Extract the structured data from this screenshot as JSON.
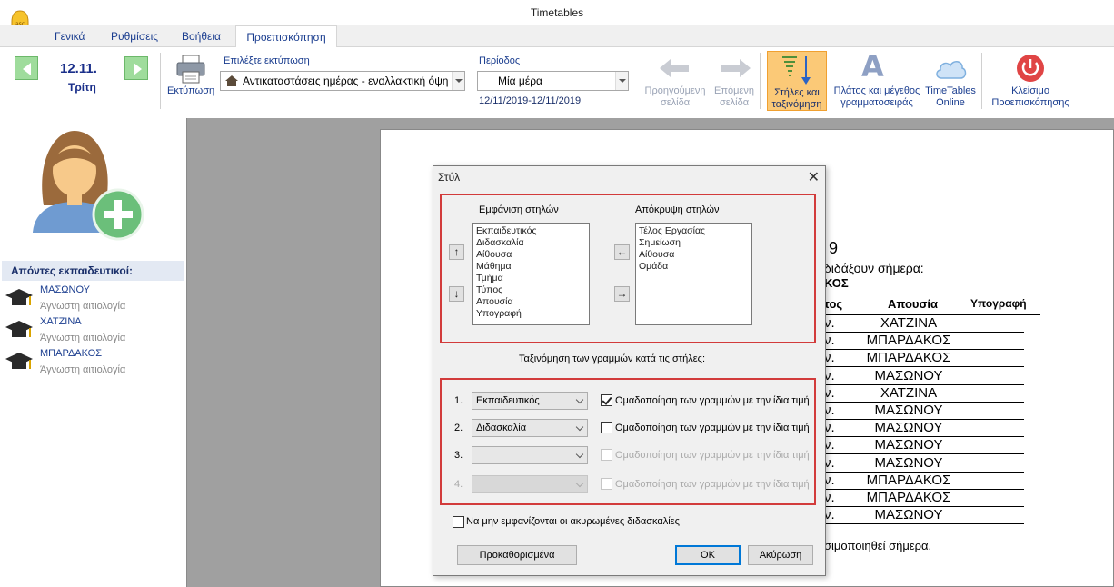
{
  "window": {
    "title": "Timetables"
  },
  "menu": {
    "tabs": [
      "Γενικά",
      "Ρυθμίσεις",
      "Βοήθεια",
      "Προεπισκόπηση"
    ],
    "active_tab": "Προεπισκόπηση"
  },
  "ribbon": {
    "date": "12.11.",
    "day": "Τρίτη",
    "print_label": "Εκτύπωση",
    "choose_print_label": "Επιλέξτε εκτύπωση",
    "print_select_value": "Αντικαταστάσεις ημέρας - εναλλακτική όψη",
    "period_label": "Περίοδος",
    "period_value": "Μία μέρα",
    "period_range": "12/11/2019-12/11/2019",
    "prev_page": "Προηγούμενη σελίδα",
    "next_page": "Επόμενη σελίδα",
    "columns_sort": "Στήλες και ταξινόμηση",
    "font_size": "Πλάτος και μέγεθος γραμματοσειράς",
    "timetables_online": "TimeTables Online",
    "close_preview": "Κλείσιμο Προεπισκόπησης",
    "accent": "#fbc977"
  },
  "left": {
    "absent_header": "Απόντες εκπαιδευτικοί:",
    "absent": [
      {
        "name": "ΜΑΣΩΝΟΥ",
        "reason": "Άγνωστη αιτιολογία"
      },
      {
        "name": "ΧΑΤΖΙΝΑ",
        "reason": "Άγνωστη αιτιολογία"
      },
      {
        "name": "ΜΠΑΡΔΑΚΟΣ",
        "reason": "Άγνωστη αιτιολογία"
      }
    ]
  },
  "paper": {
    "frag_9": "9",
    "frag_teach": "διδάξουν σήμερα:",
    "frag_kos": "ΚΟΣ",
    "col_tos": "τος",
    "col_absence": "Απουσία",
    "col_signature": "Υπογραφή",
    "rows": [
      "ΧΑΤΖΙΝΑ",
      "ΜΠΑΡΔΑΚΟΣ",
      "ΜΠΑΡΔΑΚΟΣ",
      "ΜΑΣΩΝΟΥ",
      "ΧΑΤΖΙΝΑ",
      "ΜΑΣΩΝΟΥ",
      "ΜΑΣΩΝΟΥ",
      "ΜΑΣΩΝΟΥ",
      "ΜΑΣΩΝΟΥ",
      "ΜΠΑΡΔΑΚΟΣ",
      "ΜΠΑΡΔΑΚΟΣ",
      "ΜΑΣΩΝΟΥ"
    ],
    "row_prefix": "ν.",
    "footer": "σιμοποιηθεί σήμερα."
  },
  "dialog": {
    "title": "Στύλ",
    "shown_title": "Εμφάνιση στηλών",
    "hidden_title": "Απόκρυψη στηλών",
    "shown_columns": [
      "Εκπαιδευτικός",
      "Διδασκαλία",
      "Αίθουσα",
      "Μάθημα",
      "Τμήμα",
      "Τύπος",
      "Απουσία",
      "Υπογραφή"
    ],
    "hidden_columns": [
      "Τέλος Εργασίας",
      "Σημείωση",
      "Αίθουσα",
      "Ομάδα"
    ],
    "sort_title": "Ταξινόμηση των γραμμών κατά τις στήλες:",
    "sort_rows": [
      {
        "num": "1.",
        "value": "Εκπαιδευτικός",
        "group": "Ομαδοποίηση των γραμμών με την ίδια τιμή",
        "checked": true,
        "enabled": true
      },
      {
        "num": "2.",
        "value": "Διδασκαλία",
        "group": "Ομαδοποίηση των γραμμών με την ίδια τιμή",
        "checked": false,
        "enabled": true
      },
      {
        "num": "3.",
        "value": "",
        "group": "Ομαδοποίηση των γραμμών με την ίδια τιμή",
        "checked": false,
        "enabled": false
      },
      {
        "num": "4.",
        "value": "",
        "group": "Ομαδοποίηση των γραμμών με την ίδια τιμή",
        "checked": false,
        "enabled": false
      }
    ],
    "hide_cancelled": "Να μην εμφανίζονται οι ακυρωμένες διδασκαλίες",
    "defaults_button": "Προκαθορισμένα",
    "ok_button": "OK",
    "cancel_button": "Ακύρωση",
    "highlight_color": "#d23b3b"
  }
}
